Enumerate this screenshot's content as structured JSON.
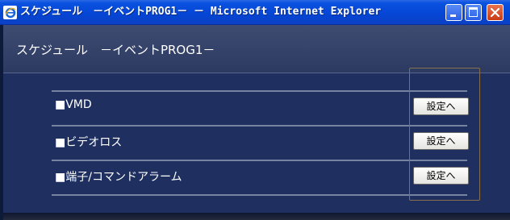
{
  "window": {
    "title": "スケジュール　－イベントPROG1－ － Microsoft Internet Explorer",
    "colors": {
      "titlebar": "#0546d6",
      "close": "#c93a14",
      "background": "#1f3060"
    }
  },
  "page": {
    "title": "スケジュール　－イベントPROG1－"
  },
  "rows": [
    {
      "label": "■VMD",
      "button": "設定へ"
    },
    {
      "label": "■ビデオロス",
      "button": "設定へ"
    },
    {
      "label": "■端子/コマンドアラーム",
      "button": "設定へ"
    }
  ]
}
